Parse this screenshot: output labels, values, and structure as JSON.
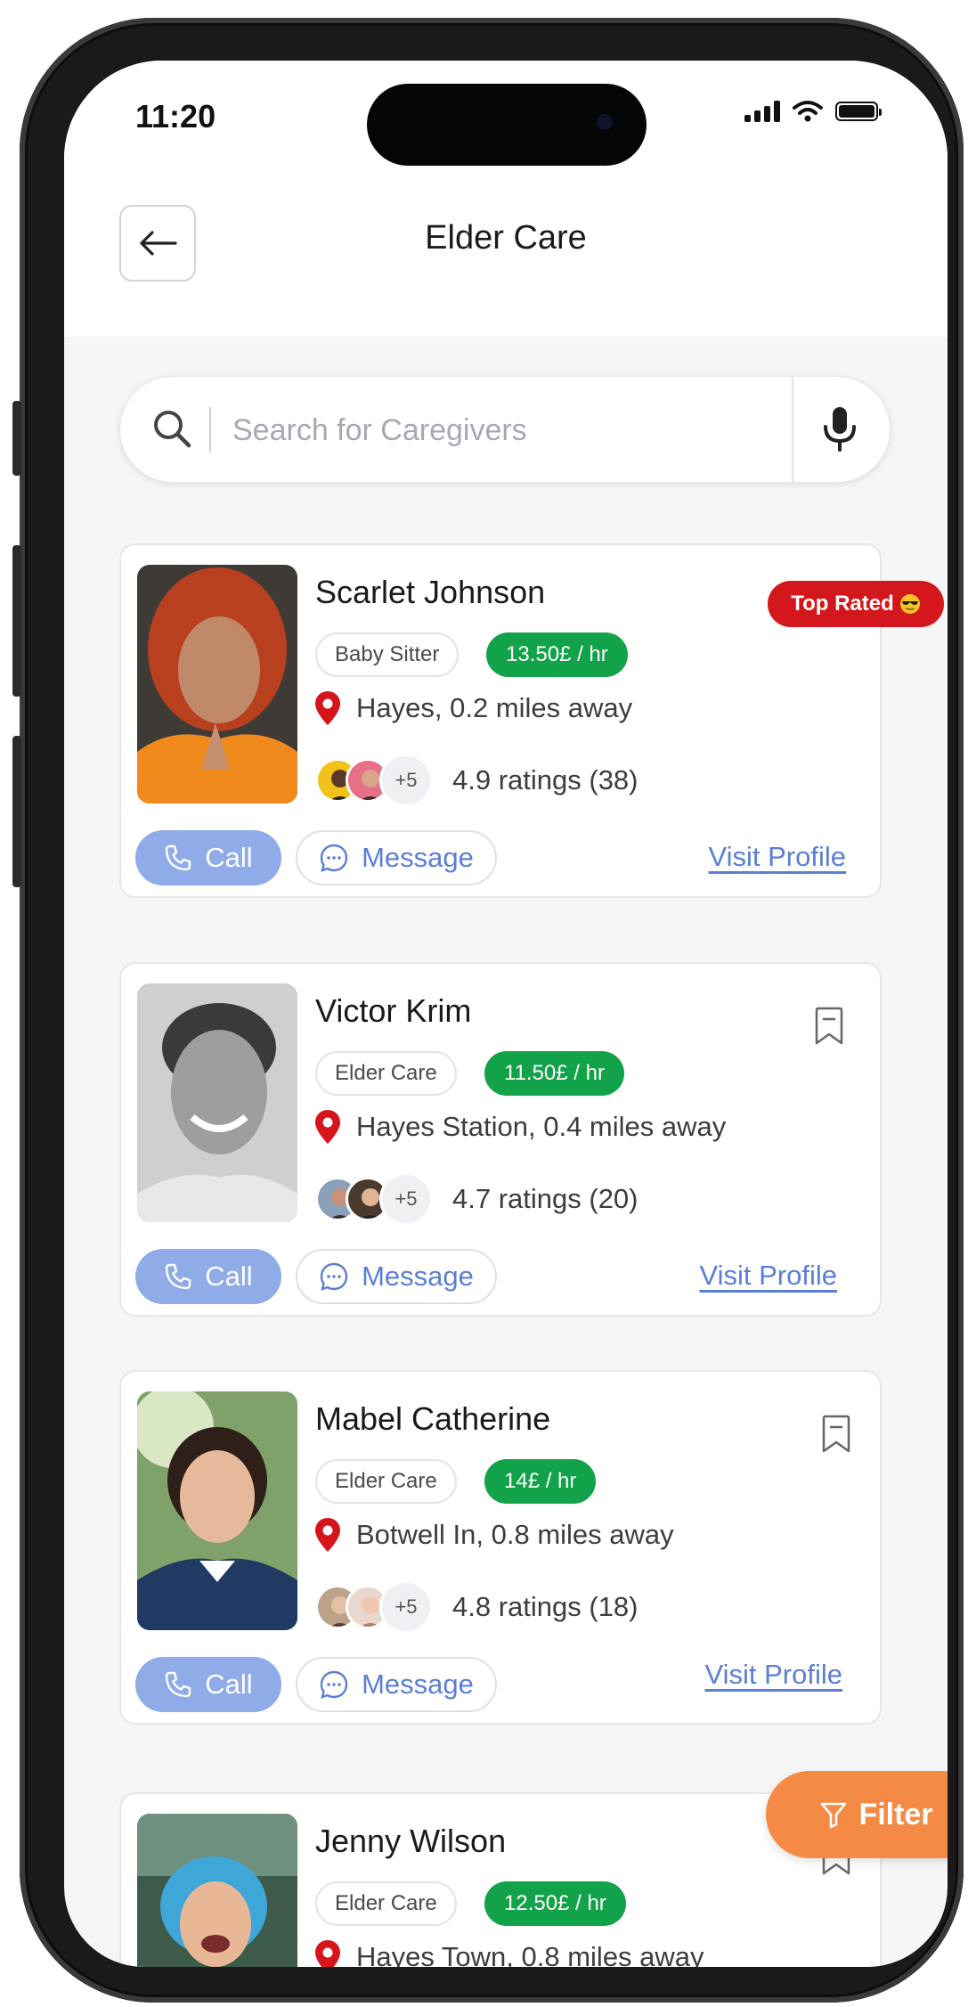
{
  "status_bar": {
    "time": "11:20"
  },
  "header": {
    "title": "Elder Care"
  },
  "search": {
    "placeholder": "Search for Caregivers"
  },
  "badge": {
    "label": "Top Rated"
  },
  "caregivers": [
    {
      "name": "Scarlet Johnson",
      "service": "Baby Sitter",
      "price": "13.50£ / hr",
      "location": "Hayes, 0.2 miles away",
      "extra_raters": "+5",
      "ratings": "4.9 ratings (38)",
      "call": "Call",
      "message": "Message",
      "visit": "Visit Profile"
    },
    {
      "name": "Victor Krim",
      "service": "Elder Care",
      "price": "11.50£ / hr",
      "location": "Hayes Station, 0.4 miles away",
      "extra_raters": "+5",
      "ratings": "4.7 ratings (20)",
      "call": "Call",
      "message": "Message",
      "visit": "Visit Profile"
    },
    {
      "name": "Mabel Catherine",
      "service": "Elder Care",
      "price": "14£ / hr",
      "location": "Botwell In, 0.8 miles away",
      "extra_raters": "+5",
      "ratings": "4.8 ratings (18)",
      "call": "Call",
      "message": "Message",
      "visit": "Visit Profile"
    },
    {
      "name": "Jenny Wilson",
      "service": "Elder Care",
      "price": "12.50£ / hr",
      "location": "Hayes Town, 0.8 miles away"
    }
  ],
  "filter": {
    "label": "Filter"
  },
  "colors": {
    "accent_green": "#12a34a",
    "call_blue": "#8fabe8",
    "link_blue": "#5b7fd6",
    "badge_red": "#d4171d",
    "filter_orange": "#f58a45",
    "pin_red": "#d6141b"
  }
}
